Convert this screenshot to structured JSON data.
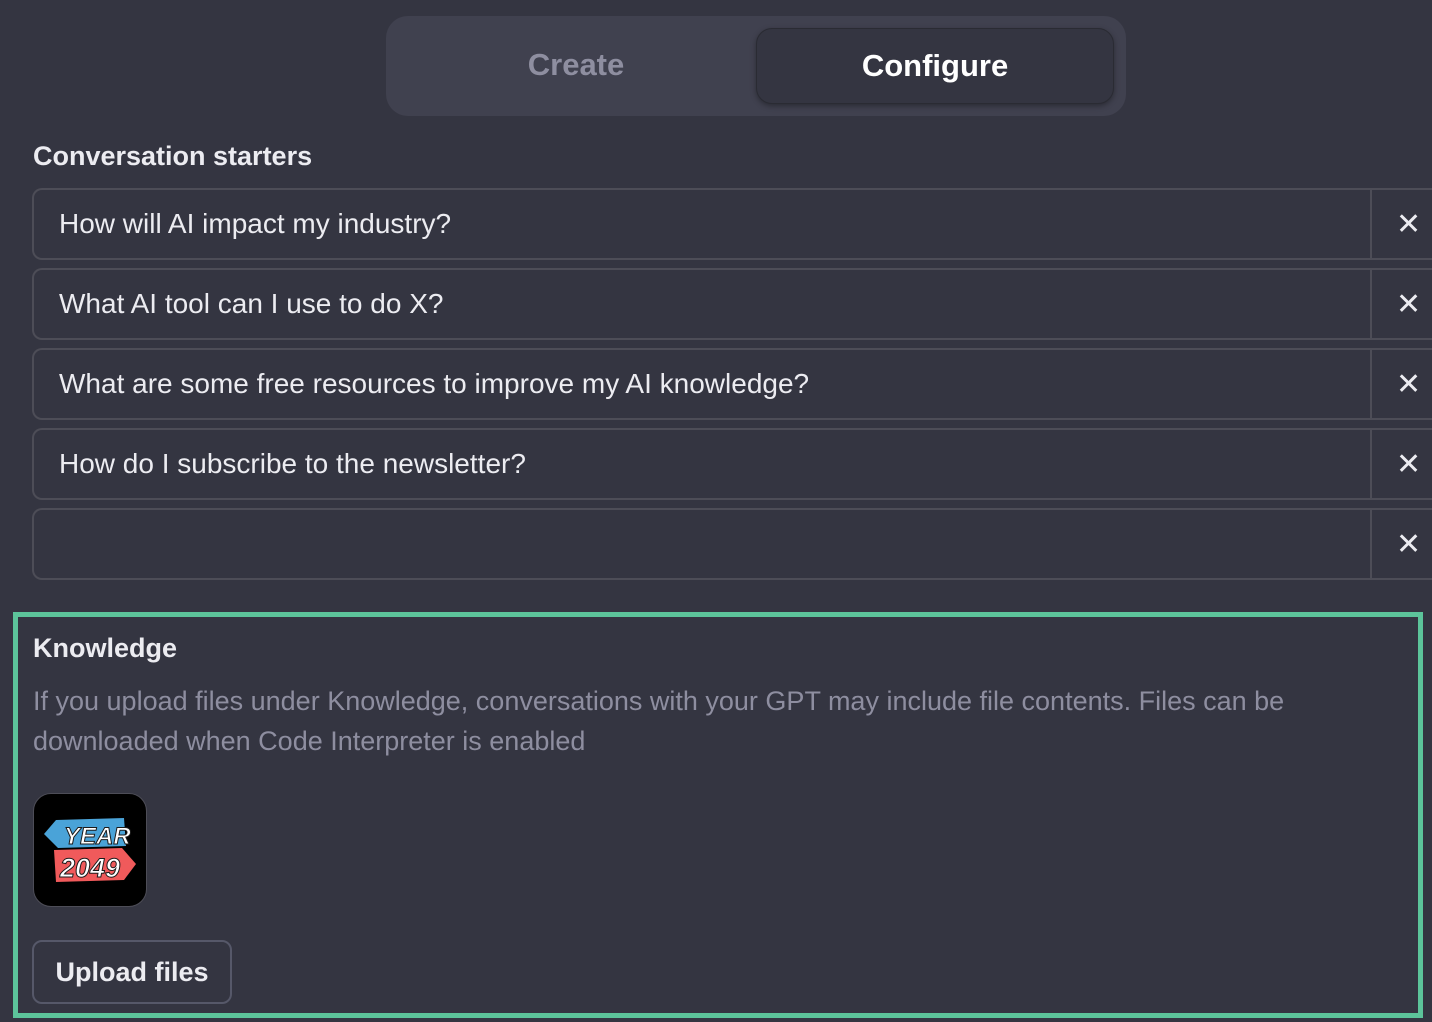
{
  "tabs": {
    "create": "Create",
    "configure": "Configure",
    "active": "configure"
  },
  "conversation_starters": {
    "heading": "Conversation starters",
    "remove_glyph": "✕",
    "items": [
      "How will AI impact my industry?",
      "What AI tool can I use to do X?",
      "What are some free resources to improve my AI knowledge?",
      "How do I subscribe to the newsletter?",
      ""
    ]
  },
  "knowledge": {
    "heading": "Knowledge",
    "description": "If you upload files under Knowledge, conversations with your GPT may include file contents. Files can be downloaded when Code Interpreter is enabled",
    "files": [
      {
        "logo_text_top": "YEAR",
        "logo_text_bottom": "2049"
      }
    ],
    "upload_label": "Upload files"
  },
  "colors": {
    "background": "#343541",
    "tab_track": "#40414f",
    "highlight_border": "#5cc49a",
    "muted_text": "#8e8ea0",
    "logo_blue": "#4aa3d8",
    "logo_red": "#f05a5b"
  }
}
